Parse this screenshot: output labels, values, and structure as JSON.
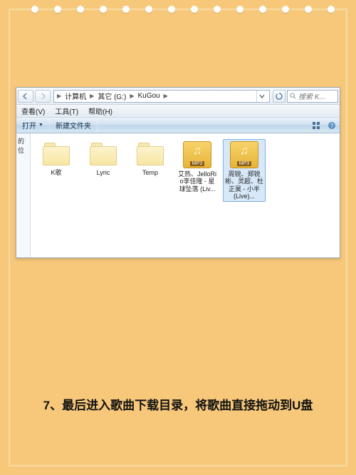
{
  "breadcrumb": {
    "items": [
      "计算机",
      "其它 (G:)",
      "KuGou"
    ],
    "sep": "▶"
  },
  "search": {
    "placeholder": "搜索 K..."
  },
  "menubar": {
    "items": [
      "查看(V)",
      "工具(T)",
      "帮助(H)"
    ]
  },
  "commandbar": {
    "open": "打开",
    "newfolder": "新建文件夹"
  },
  "sidebar": {
    "label": "的位"
  },
  "files": {
    "items": [
      {
        "type": "folder",
        "label": "K歌",
        "selected": false
      },
      {
        "type": "folder",
        "label": "Lyric",
        "selected": false
      },
      {
        "type": "folder",
        "label": "Temp",
        "selected": false
      },
      {
        "type": "mp3",
        "label": "艾热、JelloRio李佳隆 - 星球坠落 (Liv...",
        "selected": false
      },
      {
        "type": "mp3",
        "label": "周锐、郑锐彬、灵超、杜正昊 - 小半 (Live)...",
        "selected": true
      }
    ],
    "mp3_tag": "MP3"
  },
  "caption": "7、最后进入歌曲下载目录，将歌曲直接拖动到U盘"
}
